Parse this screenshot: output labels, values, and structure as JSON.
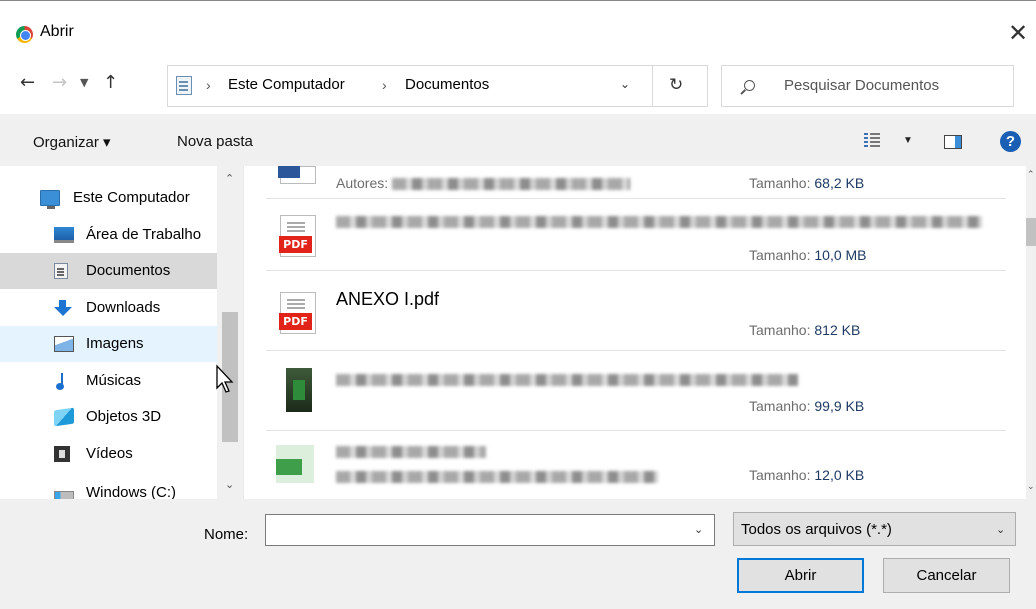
{
  "window": {
    "title": "Abrir",
    "close_glyph": "✕"
  },
  "nav": {
    "back_glyph": "←",
    "forward_glyph": "→",
    "recent_glyph": "⌄",
    "up_glyph": "↑",
    "breadcrumb": [
      "Este Computador",
      "Documentos"
    ],
    "separator": "›",
    "refresh_glyph": "↻"
  },
  "search": {
    "placeholder": "Pesquisar Documentos"
  },
  "toolbar": {
    "organize_label": "Organizar ▾",
    "new_folder_label": "Nova pasta",
    "view_dropdown": "▼",
    "help_glyph": "?"
  },
  "sidebar": {
    "items": [
      {
        "label": "Este Computador",
        "icon": "computer-icon"
      },
      {
        "label": "Área de Trabalho",
        "icon": "desktop-icon"
      },
      {
        "label": "Documentos",
        "icon": "documents-icon",
        "state": "selected"
      },
      {
        "label": "Downloads",
        "icon": "downloads-icon"
      },
      {
        "label": "Imagens",
        "icon": "pictures-icon",
        "state": "hover"
      },
      {
        "label": "Músicas",
        "icon": "music-icon"
      },
      {
        "label": "Objetos 3D",
        "icon": "3d-objects-icon"
      },
      {
        "label": "Vídeos",
        "icon": "videos-icon"
      },
      {
        "label": "Windows (C:)",
        "icon": "drive-icon"
      }
    ],
    "scroll_up": "˄",
    "scroll_down": "˅"
  },
  "files": [
    {
      "type": "word",
      "name": "",
      "author_label": "Autores:",
      "size_label": "Tamanho:",
      "size": "68,2 KB",
      "blurred": true
    },
    {
      "type": "pdf",
      "name": "",
      "size_label": "Tamanho:",
      "size": "10,0 MB",
      "blurred": true
    },
    {
      "type": "pdf",
      "name": "ANEXO I.pdf",
      "size_label": "Tamanho:",
      "size": "812 KB",
      "blurred": false
    },
    {
      "type": "image",
      "name": "",
      "size_label": "Tamanho:",
      "size": "99,9 KB",
      "blurred": true
    },
    {
      "type": "app",
      "name": "",
      "size_label": "Tamanho:",
      "size": "12,0 KB",
      "blurred": true
    }
  ],
  "pdf_badge": "PDF",
  "footer": {
    "name_label": "Nome:",
    "name_value": "",
    "filetype": "Todos os arquivos (*.*)",
    "dropdown_glyph": "⌄",
    "open_label": "Abrir",
    "cancel_label": "Cancelar"
  },
  "colors": {
    "accent": "#0078d7",
    "selected_bg": "#d9d9d9",
    "hover_bg": "#e5f3ff",
    "pdf_red": "#e2231a",
    "meta_value": "#1f3a64"
  }
}
